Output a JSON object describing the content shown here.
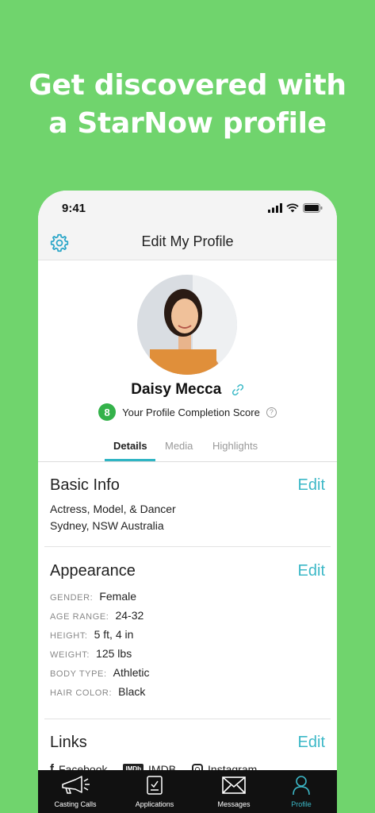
{
  "headline": {
    "line1": "Get discovered with",
    "line2": "a StarNow profile"
  },
  "status_bar": {
    "time": "9:41"
  },
  "app_bar": {
    "title": "Edit My Profile",
    "settings_icon": "gear-icon"
  },
  "profile": {
    "name": "Daisy Mecca",
    "score": "8",
    "score_label": "Your Profile Completion Score",
    "help_glyph": "?"
  },
  "tabs": [
    {
      "label": "Details",
      "active": true
    },
    {
      "label": "Media",
      "active": false
    },
    {
      "label": "Highlights",
      "active": false
    }
  ],
  "basic_info": {
    "title": "Basic Info",
    "edit_label": "Edit",
    "lines": [
      "Actress, Model, & Dancer",
      "Sydney, NSW Australia"
    ]
  },
  "appearance": {
    "title": "Appearance",
    "edit_label": "Edit",
    "attributes": [
      {
        "label": "GENDER:",
        "value": "Female"
      },
      {
        "label": "AGE RANGE:",
        "value": "24-32"
      },
      {
        "label": "HEIGHT:",
        "value": "5 ft, 4 in"
      },
      {
        "label": "WEIGHT:",
        "value": "125 lbs"
      },
      {
        "label": "BODY TYPE:",
        "value": "Athletic"
      },
      {
        "label": "HAIR COLOR:",
        "value": "Black"
      }
    ]
  },
  "links": {
    "title": "Links",
    "edit_label": "Edit",
    "items": [
      "Facebook",
      "IMDB",
      "Instagram"
    ],
    "imdb_badge": "IMDb"
  },
  "bottom_nav": [
    {
      "label": "Casting Calls",
      "icon": "megaphone-icon",
      "active": false
    },
    {
      "label": "Applications",
      "icon": "clipboard-icon",
      "active": false
    },
    {
      "label": "Messages",
      "icon": "envelope-icon",
      "active": false
    },
    {
      "label": "Profile",
      "icon": "person-icon",
      "active": true
    }
  ],
  "colors": {
    "background": "#70d46d",
    "accent": "#3cb8c7",
    "score_badge": "#34b24a",
    "nav_bar": "#111111"
  }
}
